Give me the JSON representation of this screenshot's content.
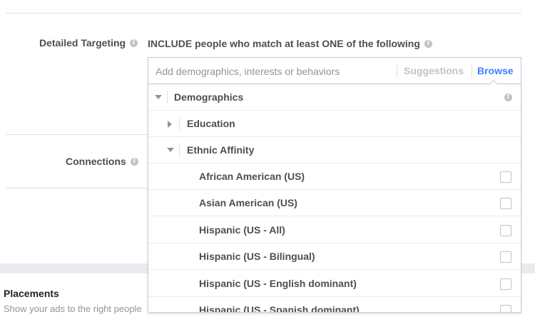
{
  "detailed_targeting": {
    "label": "Detailed Targeting",
    "include_text": "INCLUDE people who match at least ONE of the following",
    "search": {
      "placeholder": "Add demographics, interests or behaviors",
      "suggestions_label": "Suggestions",
      "browse_label": "Browse"
    }
  },
  "connections": {
    "label": "Connections"
  },
  "placements": {
    "title": "Placements",
    "subtitle": "Show your ads to the right people"
  },
  "dropdown": {
    "category": "Demographics",
    "subcategories": [
      {
        "label": "Education",
        "expanded": false
      },
      {
        "label": "Ethnic Affinity",
        "expanded": true
      }
    ],
    "options": [
      {
        "label": "African American (US)",
        "checked": false
      },
      {
        "label": "Asian American (US)",
        "checked": false
      },
      {
        "label": "Hispanic (US - All)",
        "checked": false
      },
      {
        "label": "Hispanic (US - Bilingual)",
        "checked": false
      },
      {
        "label": "Hispanic (US - English dominant)",
        "checked": false
      },
      {
        "label": "Hispanic (US - Spanish dominant)",
        "checked": false
      }
    ]
  },
  "colors": {
    "accent": "#4080ff",
    "text": "#4b4f56",
    "muted": "#90949c",
    "border": "#dddfe2"
  }
}
